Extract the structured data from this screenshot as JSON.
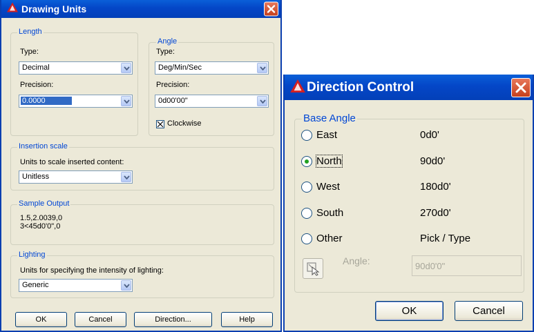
{
  "drawing_units": {
    "title": "Drawing Units",
    "length": {
      "legend": "Length",
      "type_label": "Type:",
      "type_value": "Decimal",
      "precision_label": "Precision:",
      "precision_value": "0.0000"
    },
    "angle": {
      "legend": "Angle",
      "type_label": "Type:",
      "type_value": "Deg/Min/Sec",
      "precision_label": "Precision:",
      "precision_value": "0d00'00\"",
      "clockwise_label": "Clockwise",
      "clockwise_checked": true
    },
    "insertion": {
      "legend": "Insertion scale",
      "label": "Units to scale inserted content:",
      "value": "Unitless"
    },
    "sample": {
      "legend": "Sample Output",
      "line1": "1.5,2.0039,0",
      "line2": "3<45d0'0\",0"
    },
    "lighting": {
      "legend": "Lighting",
      "label": "Units for specifying the intensity of lighting:",
      "value": "Generic"
    },
    "buttons": {
      "ok": "OK",
      "cancel": "Cancel",
      "direction": "Direction...",
      "help": "Help"
    }
  },
  "direction_control": {
    "title": "Direction Control",
    "legend": "Base Angle",
    "options": [
      {
        "label": "East",
        "value": "0d0'",
        "selected": false
      },
      {
        "label": "North",
        "value": "90d0'",
        "selected": true
      },
      {
        "label": "West",
        "value": "180d0'",
        "selected": false
      },
      {
        "label": "South",
        "value": "270d0'",
        "selected": false
      },
      {
        "label": "Other",
        "value": "Pick / Type",
        "selected": false
      }
    ],
    "angle_label": "Angle:",
    "angle_value": "90d0'0\"",
    "buttons": {
      "ok": "OK",
      "cancel": "Cancel"
    }
  },
  "colors": {
    "titlebar": "#0446c7",
    "dialog_bg": "#ece9d8",
    "group_text": "#0046d5",
    "close_button": "#c5401d"
  },
  "icons": [
    "autocad-icon",
    "close-icon",
    "dropdown-arrow-icon",
    "pick-point-icon"
  ]
}
